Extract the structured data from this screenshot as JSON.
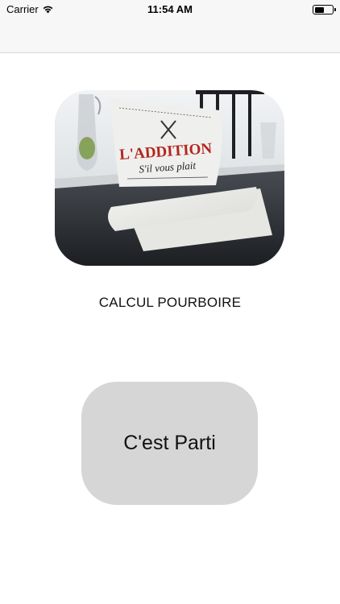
{
  "status_bar": {
    "carrier": "Carrier",
    "time": "11:54 AM",
    "battery_level": 0.55
  },
  "hero_image": {
    "title_line1": "L'ADDITION",
    "title_line2": "S'il vous plait"
  },
  "main": {
    "title": "CALCUL POURBOIRE",
    "start_button_label": "C'est Parti"
  }
}
